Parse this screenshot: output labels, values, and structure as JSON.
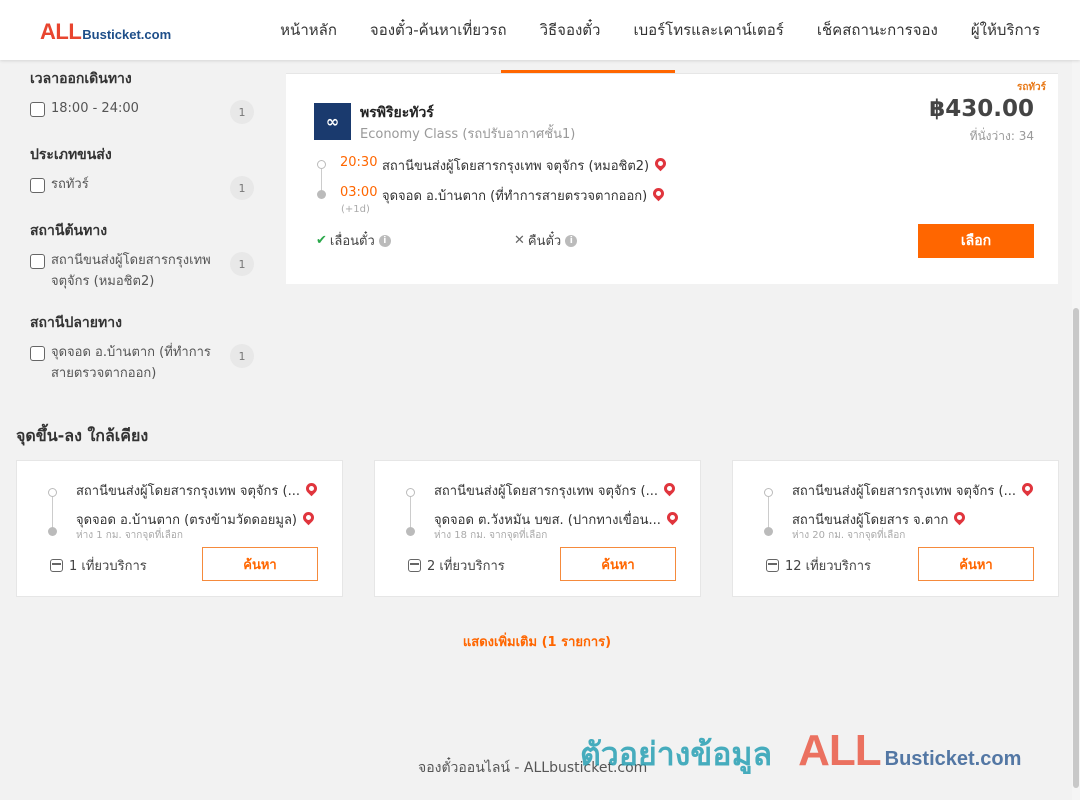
{
  "brand": {
    "logo_all": "ALL",
    "logo_bus": "Busticket.com"
  },
  "nav": [
    {
      "label": "หน้าหลัก"
    },
    {
      "label": "จองตั๋ว-ค้นหาเที่ยวรถ"
    },
    {
      "label": "วิธีจองตั๋ว"
    },
    {
      "label": "เบอร์โทรและเคาน์เตอร์"
    },
    {
      "label": "เช็คสถานะการจอง"
    },
    {
      "label": "ผู้ให้บริการ"
    }
  ],
  "filters": [
    {
      "title": "เวลาออกเดินทาง",
      "options": [
        {
          "label": "18:00 - 24:00",
          "count": "1"
        }
      ]
    },
    {
      "title": "ประเภทขนส่ง",
      "options": [
        {
          "label": "รถทัวร์",
          "count": "1"
        }
      ]
    },
    {
      "title": "สถานีต้นทาง",
      "options": [
        {
          "label": "สถานีขนส่งผู้โดยสารกรุงเทพ จตุจักร (หมอชิต2)",
          "count": "1"
        }
      ]
    },
    {
      "title": "สถานีปลายทาง",
      "options": [
        {
          "label": "จุดจอด อ.บ้านตาก (ที่ทำการสายตรวจตากออก)",
          "count": "1"
        }
      ]
    }
  ],
  "trip": {
    "bus_type": "รถทัวร์",
    "operator_name": "พรพิริยะทัวร์",
    "operator_class": "Economy Class (รถปรับอากาศชั้น1)",
    "price": "฿430.00",
    "seats": "ที่นั่งว่าง: 34",
    "depart_time": "20:30",
    "depart_stop": "สถานีขนส่งผู้โดยสารกรุงเทพ จตุจักร (หมอชิต2)",
    "arrive_time": "03:00",
    "arrive_stop": "จุดจอด อ.บ้านตาก (ที่ทำการสายตรวจตากออก)",
    "plus_day": "(+1d)",
    "reschedule_label": "เลื่อนตั๋ว",
    "refund_label": "คืนตั๋ว",
    "select_label": "เลือก"
  },
  "nearby": {
    "title": "จุดขึ้น-ลง ใกล้เคียง",
    "search_label": "ค้นหา",
    "cards": [
      {
        "from": "สถานีขนส่งผู้โดยสารกรุงเทพ จตุจักร (...",
        "to": "จุดจอด อ.บ้านตาก (ตรงข้ามวัดดอยมูล)",
        "distance": "ห่าง 1 กม. จากจุดที่เลือก",
        "trips": "1 เที่ยวบริการ"
      },
      {
        "from": "สถานีขนส่งผู้โดยสารกรุงเทพ จตุจักร (...",
        "to": "จุดจอด ต.วังหมัน บขส. (ปากทางเขื่อน...",
        "distance": "ห่าง 18 กม. จากจุดที่เลือก",
        "trips": "2 เที่ยวบริการ"
      },
      {
        "from": "สถานีขนส่งผู้โดยสารกรุงเทพ จตุจักร (...",
        "to": "สถานีขนส่งผู้โดยสาร จ.ตาก",
        "distance": "ห่าง 20 กม. จากจุดที่เลือก",
        "trips": "12 เที่ยวบริการ"
      }
    ]
  },
  "show_more": "แสดงเพิ่มเติม (1 รายการ)",
  "footer": "จองตั๋วออนไลน์ - ALLbusticket.com",
  "watermark": {
    "text": "ตัวอย่างข้อมูล",
    "all": "ALL",
    "bus": "Busticket.com"
  },
  "colors": {
    "accent": "#ff6600",
    "pin": "#e0353d",
    "check": "#2aa84a"
  },
  "icons": {
    "check": "check-icon",
    "close": "x-icon",
    "info": "info-icon",
    "pin": "map-pin-icon",
    "bus": "bus-icon"
  }
}
